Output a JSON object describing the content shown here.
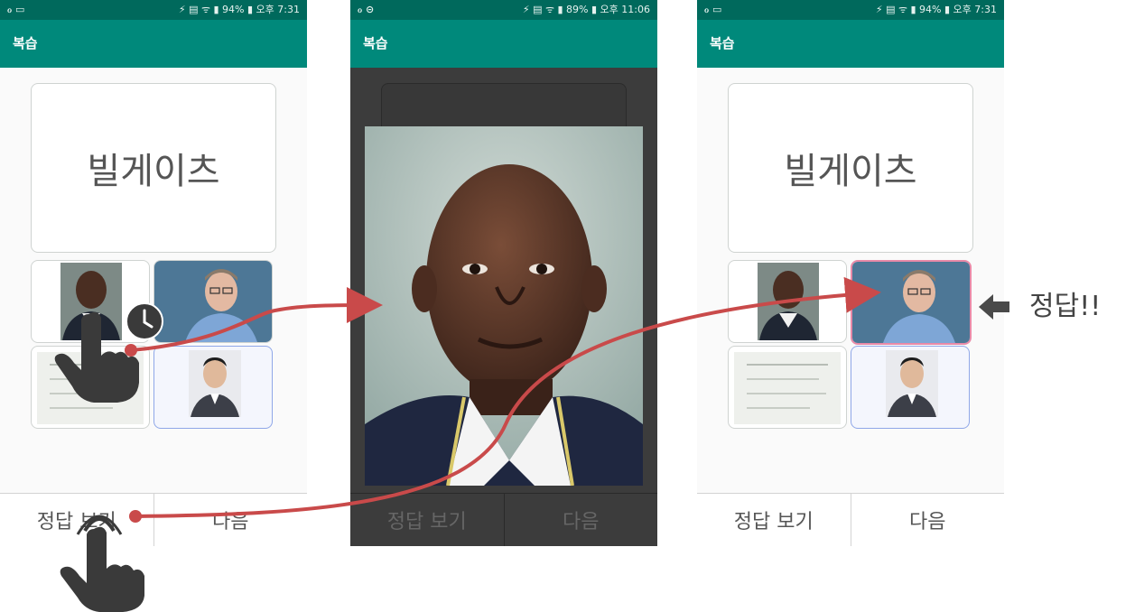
{
  "phones": [
    {
      "status": {
        "left": "ℴ ▭",
        "right": "⚡ ▤ ᯤ ▮ 94% ▮ 오후 7:31"
      },
      "title": "복습",
      "word": "빌게이츠",
      "buttons": {
        "show_answer": "정답 보기",
        "next": "다음"
      }
    },
    {
      "status": {
        "left": "ℴ ⊝",
        "right": "⚡ ▤ ᯤ ▮ 89% ▮ 오후 11:06"
      },
      "title": "복습",
      "buttons": {
        "show_answer": "정답 보기",
        "next": "다음"
      }
    },
    {
      "status": {
        "left": "ℴ ▭",
        "right": "⚡ ▤ ᯤ ▮ 94% ▮ 오후 7:31"
      },
      "title": "복습",
      "word": "빌게이츠",
      "buttons": {
        "show_answer": "정답 보기",
        "next": "다음"
      }
    }
  ],
  "answer_label": "정답!!",
  "colors": {
    "status_bar": "#00695c",
    "app_bar": "#00897b",
    "arrow": "#c94a4a",
    "hand": "#3a3a3a",
    "correct_border": "#e98aa8",
    "selected_border": "#8fa7e8"
  },
  "icons": [
    "hand-pointer-icon",
    "clock-icon",
    "left-arrow-icon"
  ]
}
